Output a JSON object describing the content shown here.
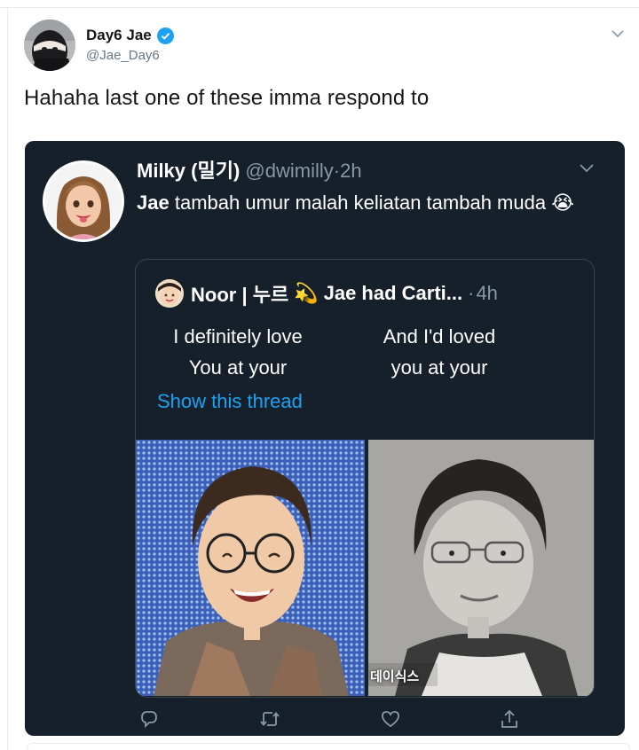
{
  "outer_tweet": {
    "display_name": "Day6 Jae",
    "handle": "@Jae_Day6",
    "text": "Hahaha last one of these imma respond to",
    "verified_color": "#1da1f2"
  },
  "embedded_tweet": {
    "display_name": "Milky (밀기)",
    "handle": "@dwimilly",
    "separator": "·",
    "time": "2h",
    "text_bold": "Jae",
    "text_rest": "tambah umur malah keliatan tambah muda",
    "emoji": "😭"
  },
  "quoted_tweet": {
    "author": "Noor | 누르",
    "emoji": "💫",
    "author_rest": "Jae had Carti...",
    "separator": "·",
    "time": "4h",
    "left_line1": "I definitely love",
    "left_line2": "You at your",
    "right_line1": "And I'd loved",
    "right_line2": "you at your",
    "show_thread": "Show this thread",
    "photo_watermark": "데이식스"
  },
  "actions": [
    {
      "icon": "reply-icon"
    },
    {
      "icon": "retweet-icon"
    },
    {
      "icon": "like-icon"
    },
    {
      "icon": "share-icon"
    }
  ],
  "colors": {
    "card_bg": "#15202b",
    "link": "#1da1f2",
    "muted": "#8899a6"
  }
}
